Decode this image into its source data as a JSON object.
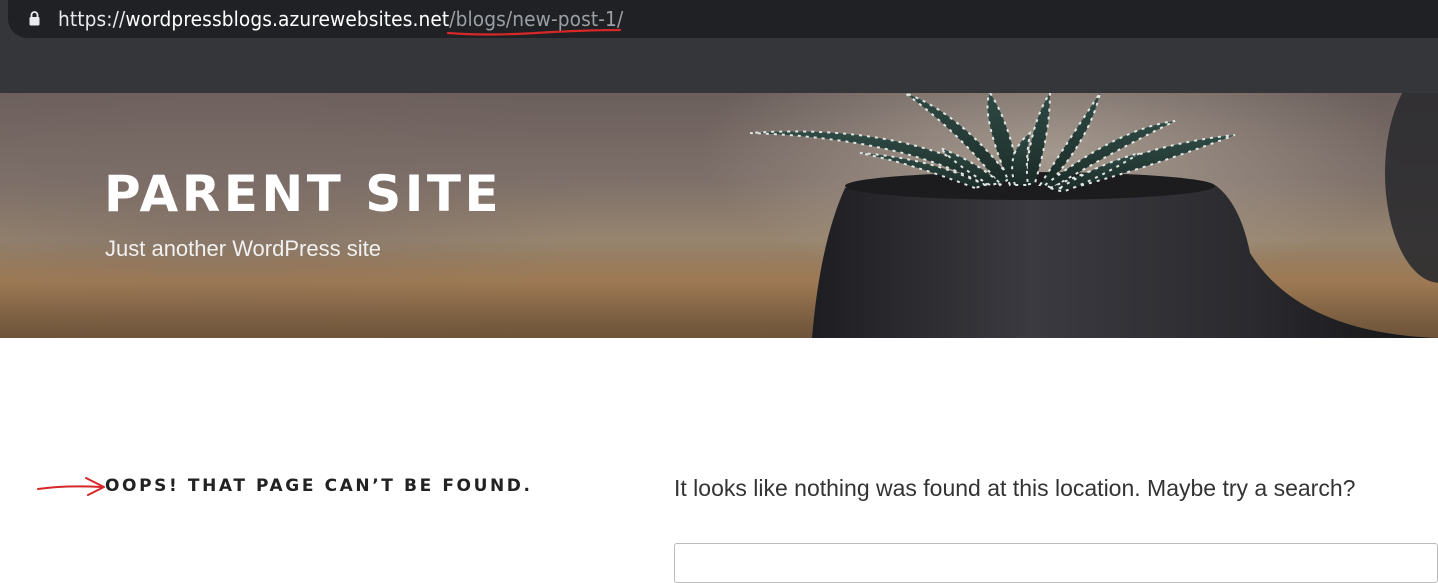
{
  "browser": {
    "url_scheme": "https://",
    "url_host": "wordpressblogs.azurewebsites.net",
    "url_path": "/blogs/new-post-1/"
  },
  "site": {
    "title": "PARENT SITE",
    "tagline": "Just another WordPress site"
  },
  "content": {
    "error_title": "OOPS! THAT PAGE CAN’T BE FOUND.",
    "message": "It looks like nothing was found at this location. Maybe try a search?",
    "search_value": ""
  },
  "annotations": {
    "color": "#d62828"
  }
}
